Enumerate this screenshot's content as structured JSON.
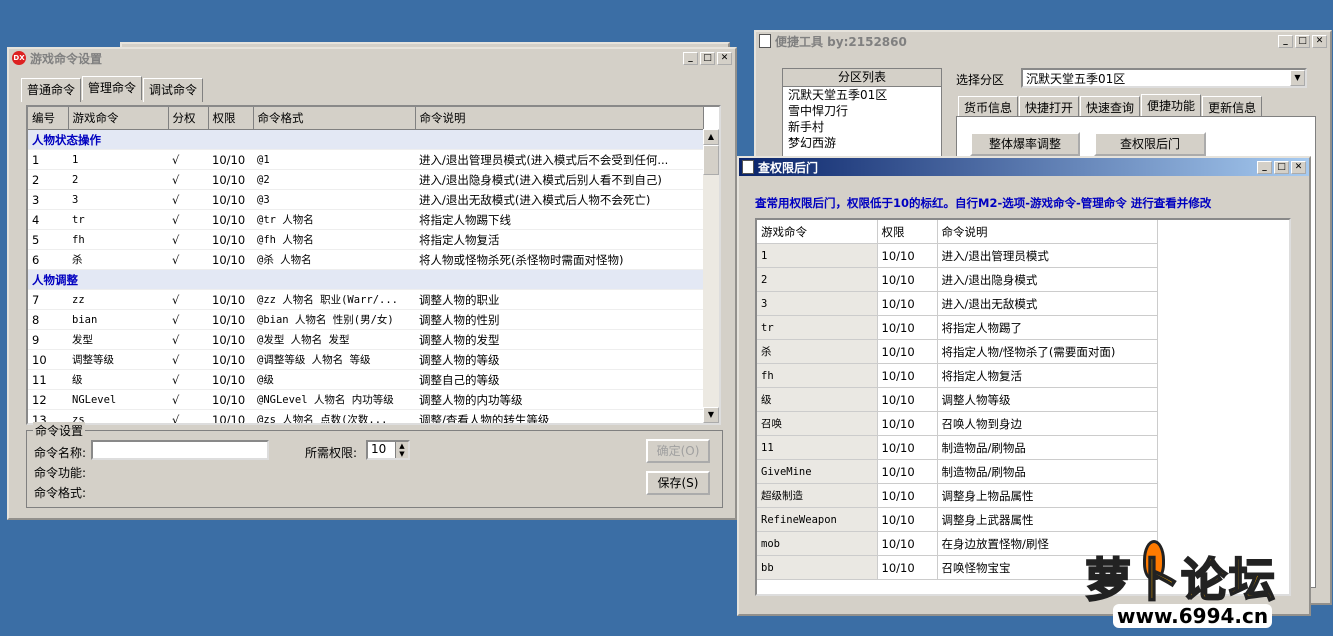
{
  "win1": {
    "title": "游戏命令设置",
    "tabs": [
      "普通命令",
      "管理命令",
      "调试命令"
    ],
    "columns": [
      "编号",
      "游戏命令",
      "分权",
      "权限",
      "命令格式",
      "命令说明"
    ],
    "group1": "人物状态操作",
    "rows1": [
      [
        "1",
        "1",
        "√",
        "10/10",
        "@1",
        "进入/退出管理员模式(进入模式后不会受到任何..."
      ],
      [
        "2",
        "2",
        "√",
        "10/10",
        "@2",
        "进入/退出隐身模式(进入模式后别人看不到自己)"
      ],
      [
        "3",
        "3",
        "√",
        "10/10",
        "@3",
        "进入/退出无敌模式(进入模式后人物不会死亡)"
      ],
      [
        "4",
        "tr",
        "√",
        "10/10",
        "@tr 人物名",
        "将指定人物踢下线"
      ],
      [
        "5",
        "fh",
        "√",
        "10/10",
        "@fh 人物名",
        "将指定人物复活"
      ],
      [
        "6",
        "杀",
        "√",
        "10/10",
        "@杀 人物名",
        "将人物或怪物杀死(杀怪物时需面对怪物)"
      ]
    ],
    "group2": "人物调整",
    "rows2": [
      [
        "7",
        "zz",
        "√",
        "10/10",
        "@zz 人物名 职业(Warr/...",
        "调整人物的职业"
      ],
      [
        "8",
        "bian",
        "√",
        "10/10",
        "@bian 人物名 性别(男/女)",
        "调整人物的性别"
      ],
      [
        "9",
        "发型",
        "√",
        "10/10",
        "@发型 人物名 发型",
        "调整人物的发型"
      ],
      [
        "10",
        "调整等级",
        "√",
        "10/10",
        "@调整等级 人物名 等级",
        "调整人物的等级"
      ],
      [
        "11",
        "级",
        "√",
        "10/10",
        "@级",
        "调整自己的等级"
      ],
      [
        "12",
        "NGLevel",
        "√",
        "10/10",
        "@NGLevel 人物名 内功等级",
        "调整人物的内功等级"
      ],
      [
        "13",
        "zs",
        "√",
        "10/10",
        "@zs 人物名 点数(次数...",
        "调整/查看人物的转生等级"
      ]
    ],
    "settings": {
      "group_label": "命令设置",
      "name_label": "命令名称:",
      "name_value": "",
      "perm_label": "所需权限:",
      "perm_value": "10",
      "func_label": "命令功能:",
      "format_label": "命令格式:",
      "ok_label": "确定(O)",
      "save_label": "保存(S)"
    }
  },
  "win2": {
    "title": "便捷工具  by:2152860",
    "zone_list_header": "分区列表",
    "zones": [
      "沉默天堂五季01区",
      "雪中悍刀行",
      "新手村",
      "梦幻西游"
    ],
    "select_label": "选择分区",
    "select_value": "沉默天堂五季01区",
    "tabs": [
      "货币信息",
      "快捷打开",
      "快速查询",
      "便捷功能",
      "更新信息"
    ],
    "btn1": "整体爆率调整",
    "btn2": "查权限后门"
  },
  "win3": {
    "title": "查权限后门",
    "notice": "查常用权限后门，权限低于10的标红。自行M2-选项-游戏命令-管理命令 进行查看并修改",
    "columns": [
      "游戏命令",
      "权限",
      "命令说明"
    ],
    "rows": [
      [
        "1",
        "10/10",
        "进入/退出管理员模式"
      ],
      [
        "2",
        "10/10",
        "进入/退出隐身模式"
      ],
      [
        "3",
        "10/10",
        "进入/退出无敌模式"
      ],
      [
        "tr",
        "10/10",
        "将指定人物踢了"
      ],
      [
        "杀",
        "10/10",
        "将指定人物/怪物杀了(需要面对面)"
      ],
      [
        "fh",
        "10/10",
        "将指定人物复活"
      ],
      [
        "级",
        "10/10",
        "调整人物等级"
      ],
      [
        "召唤",
        "10/10",
        "召唤人物到身边"
      ],
      [
        "11",
        "10/10",
        "制造物品/刷物品"
      ],
      [
        "GiveMine",
        "10/10",
        "制造物品/刷物品"
      ],
      [
        "超级制造",
        "10/10",
        "调整身上物品属性"
      ],
      [
        "RefineWeapon",
        "10/10",
        "调整身上武器属性"
      ],
      [
        "mob",
        "10/10",
        "在身边放置怪物/刷怪"
      ],
      [
        "bb",
        "10/10",
        "召唤怪物宝宝"
      ]
    ]
  },
  "watermark": {
    "logo_text": "萝卜论坛",
    "url": "www.6994.cn"
  },
  "colors": {
    "desktop": "#3b6ea5",
    "active_title": "#0a246a",
    "group_text": "#0000c0"
  }
}
